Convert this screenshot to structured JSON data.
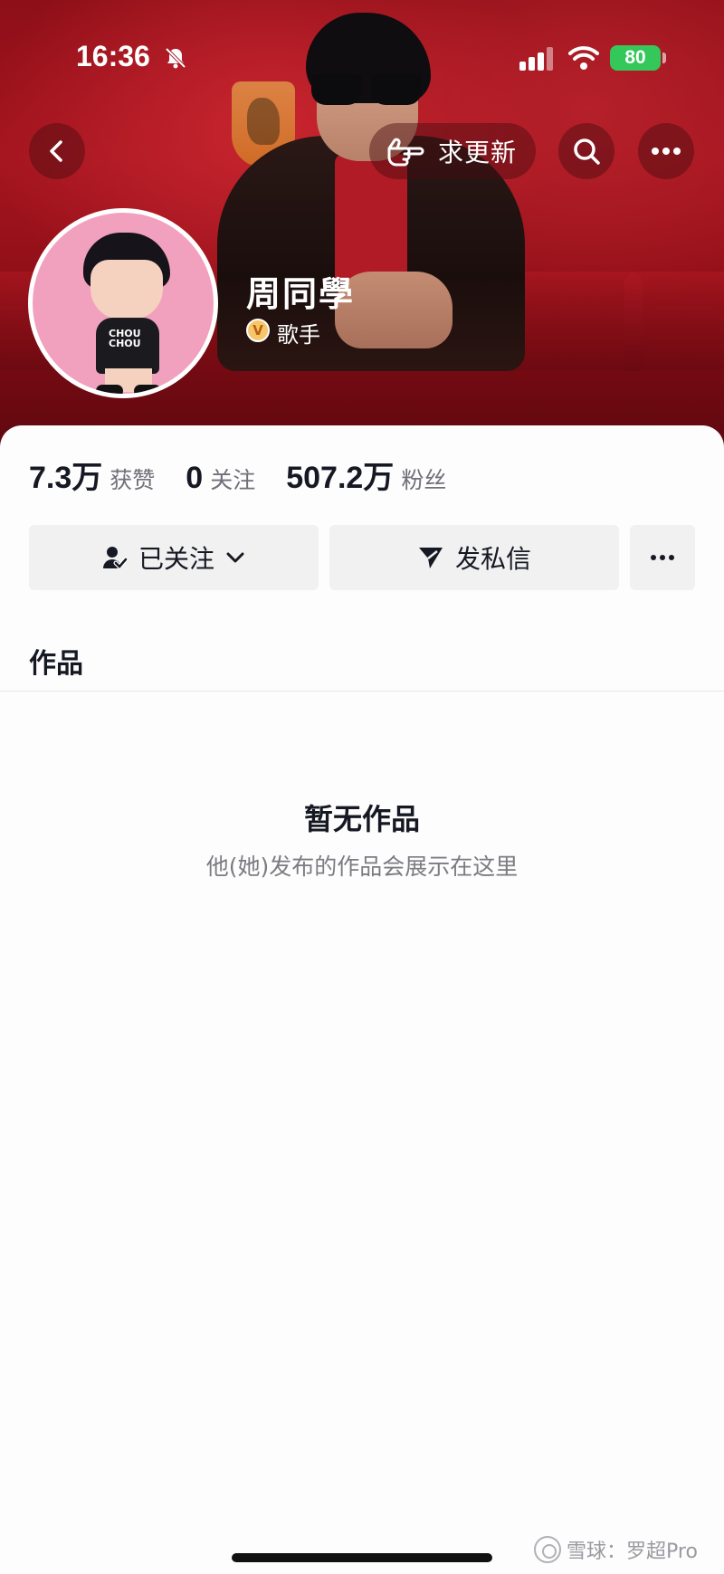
{
  "status_bar": {
    "time": "16:36",
    "battery": "80"
  },
  "nav": {
    "request_update_label": "求更新"
  },
  "profile": {
    "name": "周同學",
    "role": "歌手",
    "verified_badge": "V",
    "avatar_shirt_text": "CHOU\nCHOU"
  },
  "stats": {
    "likes_value": "7.3万",
    "likes_label": "获赞",
    "following_value": "0",
    "following_label": "关注",
    "followers_value": "507.2万",
    "followers_label": "粉丝"
  },
  "actions": {
    "follow_label": "已关注",
    "message_label": "发私信"
  },
  "tabs": {
    "works_label": "作品"
  },
  "empty_state": {
    "title": "暂无作品",
    "subtitle": "他(她)发布的作品会展示在这里"
  },
  "watermark": {
    "text": "雪球：罗超Pro"
  },
  "colors": {
    "banner_red": "#a4151f",
    "battery_green": "#34c759",
    "button_bg": "#f1f1f2",
    "text_primary": "#161823",
    "text_secondary": "#6f7079"
  },
  "icons": {
    "status": [
      "bell-off-icon",
      "signal-icon",
      "wifi-icon",
      "battery-icon"
    ],
    "nav": [
      "back-icon",
      "hand-point-icon",
      "search-icon",
      "more-icon"
    ],
    "actions": [
      "user-check-icon",
      "chevron-down-icon",
      "send-icon",
      "more-icon"
    ]
  }
}
